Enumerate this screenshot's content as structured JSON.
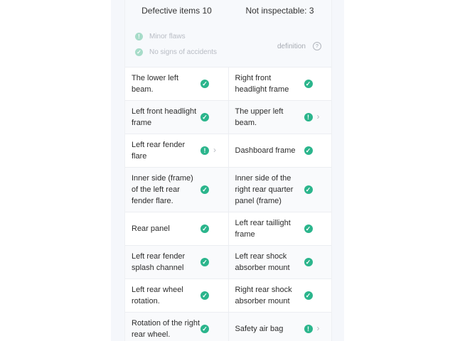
{
  "summary": {
    "defective": "Defective items 10",
    "not_inspectable": "Not inspectable: 3"
  },
  "legend": {
    "minor": "Minor flaws",
    "no_accident": "No signs of accidents",
    "definition": "definition",
    "help": "?"
  },
  "rows": [
    {
      "left": {
        "label": "The lower left beam.",
        "status": "ok"
      },
      "right": {
        "label": "Right front headlight frame",
        "status": "ok"
      }
    },
    {
      "left": {
        "label": "Left front headlight frame",
        "status": "ok"
      },
      "right": {
        "label": "The upper left beam.",
        "status": "warn"
      }
    },
    {
      "left": {
        "label": "Left rear fender flare",
        "status": "warn"
      },
      "right": {
        "label": "Dashboard frame",
        "status": "ok"
      }
    },
    {
      "left": {
        "label": "Inner side (frame) of the left rear fender flare.",
        "status": "ok"
      },
      "right": {
        "label": "Inner side of the right rear quarter panel (frame)",
        "status": "ok"
      }
    },
    {
      "left": {
        "label": "Rear panel",
        "status": "ok"
      },
      "right": {
        "label": "Left rear taillight frame",
        "status": "ok"
      }
    },
    {
      "left": {
        "label": "Left rear fender splash channel",
        "status": "ok"
      },
      "right": {
        "label": "Left rear shock absorber mount",
        "status": "ok"
      }
    },
    {
      "left": {
        "label": "Left rear wheel rotation.",
        "status": "ok"
      },
      "right": {
        "label": "Right rear shock absorber mount",
        "status": "ok"
      }
    },
    {
      "left": {
        "label": "Rotation of the right rear wheel.",
        "status": "ok"
      },
      "right": {
        "label": "Safety air bag",
        "status": "warn"
      }
    }
  ],
  "icons": {
    "ok": "check-circle-icon",
    "warn": "exclamation-circle-icon",
    "chevron": "chevron-right-icon"
  },
  "colors": {
    "status_green": "#2bb58c"
  }
}
